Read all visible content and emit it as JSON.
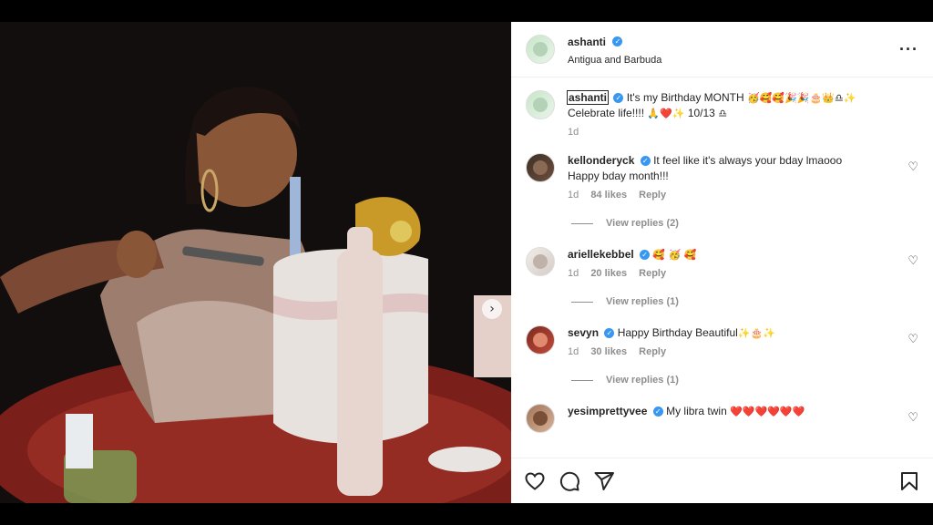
{
  "post": {
    "username": "ashanti",
    "location": "Antigua and Barbuda",
    "caption": {
      "username": "ashanti",
      "text_line1": "It's my Birthday MONTH",
      "emojis_line1": "🥳🥰🥰🎉🎉🎂👑♎✨",
      "text_line2": "Celebrate life!!!!",
      "emojis_line2a": "🙏❤️✨",
      "date": "10/13",
      "emojis_line2b": "♎",
      "time": "1d"
    }
  },
  "comments": [
    {
      "username": "kellonderyck",
      "text": "It feel like it's always your bday lmaooo",
      "text2": "Happy bday month!!!",
      "emojis": "",
      "time": "1d",
      "likes": "84 likes",
      "reply": "Reply",
      "view_replies": "View replies (2)"
    },
    {
      "username": "ariellekebbel",
      "text": "",
      "text2": "",
      "emojis": "🥰 🥳 🥰",
      "time": "1d",
      "likes": "20 likes",
      "reply": "Reply",
      "view_replies": "View replies (1)"
    },
    {
      "username": "sevyn",
      "text": "Happy Birthday Beautiful",
      "text2": "",
      "emojis": "✨🎂✨",
      "time": "1d",
      "likes": "30 likes",
      "reply": "Reply",
      "view_replies": "View replies (1)"
    },
    {
      "username": "yesimprettyvee",
      "text": "My libra twin",
      "text2": "",
      "emojis": "❤️❤️❤️❤️❤️❤️",
      "time": "",
      "likes": "",
      "reply": "",
      "view_replies": ""
    }
  ],
  "icons": {
    "verified": "✓",
    "more": "···",
    "heart_outline": "♡",
    "carousel_next": "›"
  },
  "colors": {
    "verified_blue": "#3897f0",
    "meta_gray": "#8e8e8e",
    "text_dark": "#262626"
  }
}
